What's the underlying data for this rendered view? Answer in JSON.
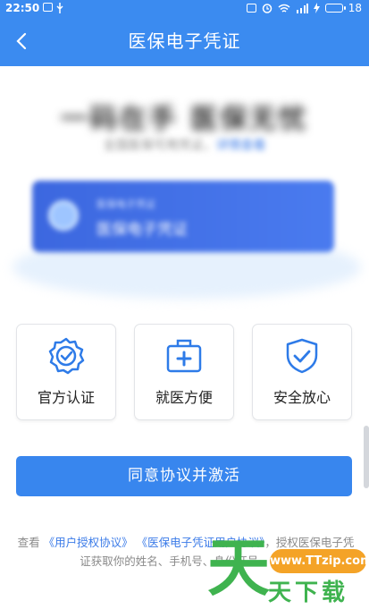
{
  "status_bar": {
    "time": "22:50",
    "battery": "18"
  },
  "nav": {
    "title": "医保电子凭证"
  },
  "hero": {
    "title": "一码在手  医保无忧",
    "subtitle": "全国医保可用凭证，",
    "subtitle_link": "详情查看"
  },
  "card": {
    "line1": "医保电子凭证",
    "line2": "医保电子凭证"
  },
  "features": [
    {
      "label": "官方认证",
      "icon": "certified-badge-icon"
    },
    {
      "label": "就医方便",
      "icon": "medical-kit-icon"
    },
    {
      "label": "安全放心",
      "icon": "shield-check-icon"
    }
  ],
  "cta_label": "同意协议并激活",
  "agreement": {
    "prefix": "查看",
    "link1": "《用户授权协议》",
    "link2": "《医保电子凭证用户协议》",
    "suffix": "，授权医保电子凭证获取你的姓名、手机号、身份证号、市民"
  },
  "watermark": {
    "badge": "www.TTzip.com",
    "mark": "天",
    "logo": "天下载"
  },
  "colors": {
    "primary": "#3b8bf0",
    "button": "#3886ee",
    "link": "#3b7be8",
    "watermark_green": "#3fb34f",
    "watermark_orange": "#f4a327"
  }
}
